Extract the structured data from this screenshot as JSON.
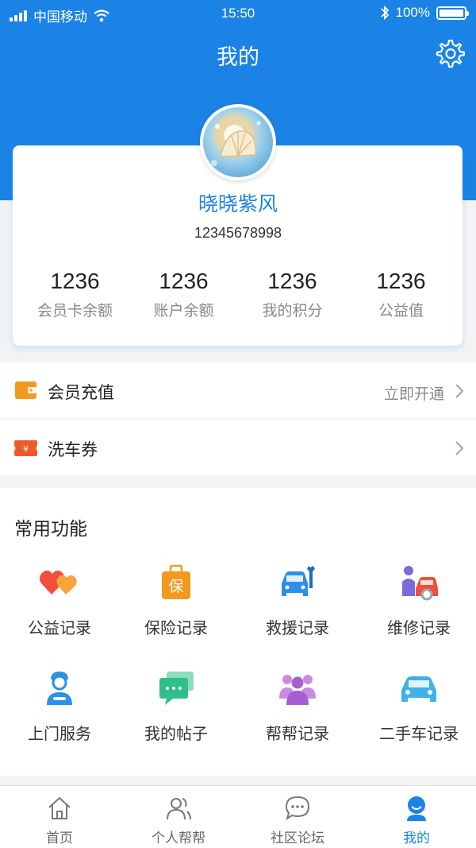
{
  "status_bar": {
    "carrier": "中国移动",
    "time": "15:50",
    "battery": "100%"
  },
  "header": {
    "title": "我的"
  },
  "profile": {
    "username": "晓晓紫风",
    "phone": "12345678998"
  },
  "stats": [
    {
      "value": "1236",
      "label": "会员卡余额"
    },
    {
      "value": "1236",
      "label": "账户余额"
    },
    {
      "value": "1236",
      "label": "我的积分"
    },
    {
      "value": "1236",
      "label": "公益值"
    }
  ],
  "rows": [
    {
      "label": "会员充值",
      "value": "立即开通",
      "icon": "wallet-icon"
    },
    {
      "label": "洗车券",
      "value": "",
      "icon": "ticket-icon"
    }
  ],
  "features": {
    "title": "常用功能",
    "items": [
      {
        "label": "公益记录",
        "icon": "hearts-icon"
      },
      {
        "label": "保险记录",
        "icon": "insurance-bag-icon"
      },
      {
        "label": "救援记录",
        "icon": "car-wrench-icon"
      },
      {
        "label": "维修记录",
        "icon": "mechanic-car-icon"
      },
      {
        "label": "上门服务",
        "icon": "service-worker-icon"
      },
      {
        "label": "我的帖子",
        "icon": "chat-bubbles-icon"
      },
      {
        "label": "帮帮记录",
        "icon": "group-people-icon"
      },
      {
        "label": "二手车记录",
        "icon": "car-icon"
      }
    ]
  },
  "tabs": [
    {
      "label": "首页",
      "icon": "home-icon",
      "active": false
    },
    {
      "label": "个人帮帮",
      "icon": "people-icon",
      "active": false
    },
    {
      "label": "社区论坛",
      "icon": "chat-icon",
      "active": false
    },
    {
      "label": "我的",
      "icon": "profile-icon",
      "active": true
    }
  ],
  "colors": {
    "primary": "#1b83e6",
    "background": "#f2f3f5",
    "orange": "#f39a1e"
  }
}
